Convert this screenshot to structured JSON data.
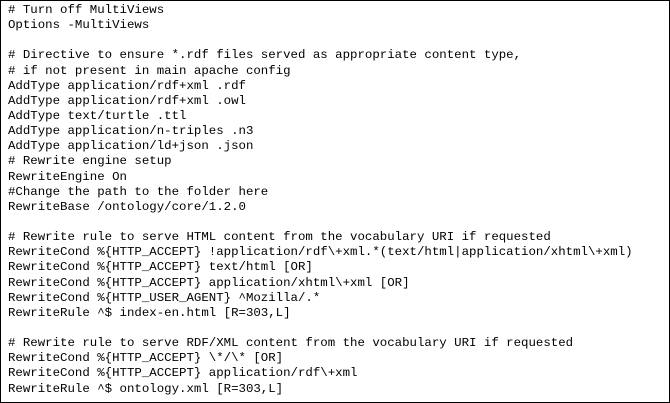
{
  "editor": {
    "lines": [
      "# Turn off MultiViews",
      "Options -MultiViews",
      "",
      "# Directive to ensure *.rdf files served as appropriate content type,",
      "# if not present in main apache config",
      "AddType application/rdf+xml .rdf",
      "AddType application/rdf+xml .owl",
      "AddType text/turtle .ttl",
      "AddType application/n-triples .n3",
      "AddType application/ld+json .json",
      "# Rewrite engine setup",
      "RewriteEngine On",
      "#Change the path to the folder here",
      "RewriteBase /ontology/core/1.2.0",
      "",
      "# Rewrite rule to serve HTML content from the vocabulary URI if requested",
      "RewriteCond %{HTTP_ACCEPT} !application/rdf\\+xml.*(text/html|application/xhtml\\+xml)",
      "RewriteCond %{HTTP_ACCEPT} text/html [OR]",
      "RewriteCond %{HTTP_ACCEPT} application/xhtml\\+xml [OR]",
      "RewriteCond %{HTTP_USER_AGENT} ^Mozilla/.*",
      "RewriteRule ^$ index-en.html [R=303,L]",
      "",
      "# Rewrite rule to serve RDF/XML content from the vocabulary URI if requested",
      "RewriteCond %{HTTP_ACCEPT} \\*/\\* [OR]",
      "RewriteCond %{HTTP_ACCEPT} application/rdf\\+xml",
      "RewriteRule ^$ ontology.xml [R=303,L]"
    ]
  }
}
